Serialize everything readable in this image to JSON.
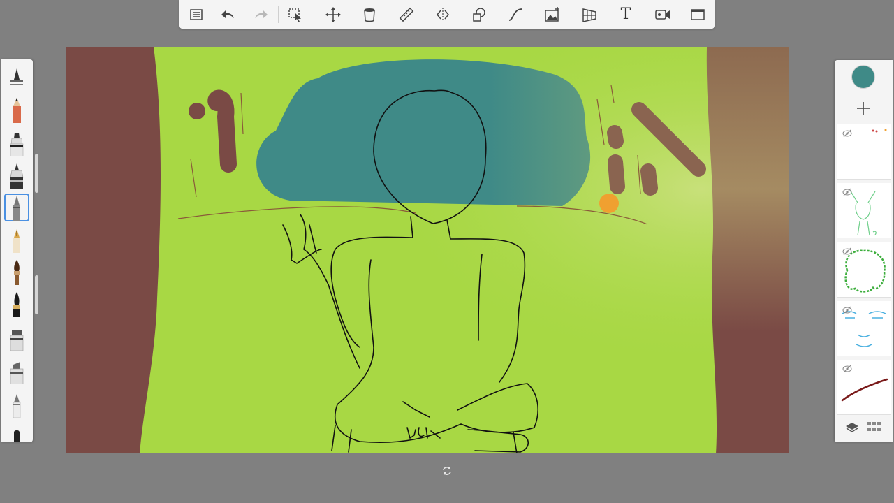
{
  "toolbar": {
    "text_tool_label": "T",
    "icons": [
      "list-icon",
      "undo-icon",
      "redo-icon",
      "selection-icon",
      "transform-icon",
      "fill-icon",
      "ruler-icon",
      "symmetry-icon",
      "shapes-icon",
      "stroke-icon",
      "image-import-icon",
      "perspective-icon",
      "text-icon",
      "recording-icon",
      "fullscreen-icon"
    ]
  },
  "brushes": {
    "items": [
      "brush-settings",
      "pencil",
      "marker",
      "pen-nib",
      "ballpoint",
      "fountain-pen",
      "paintbrush",
      "ink-brush",
      "airbrush",
      "chisel-marker",
      "eraser",
      "smudge"
    ],
    "selected": "ballpoint"
  },
  "layers": {
    "current_color": "#3f8a87",
    "items": [
      "layer-1",
      "layer-2",
      "layer-3",
      "layer-4",
      "layer-5"
    ]
  },
  "colors": {
    "background": "#808080",
    "panel": "#f4f4f4",
    "canvas_green": "#a8d844",
    "trunk_brown": "#7a4a45",
    "bush_teal": "#3f8a87",
    "accent_orange": "#f0a030"
  }
}
